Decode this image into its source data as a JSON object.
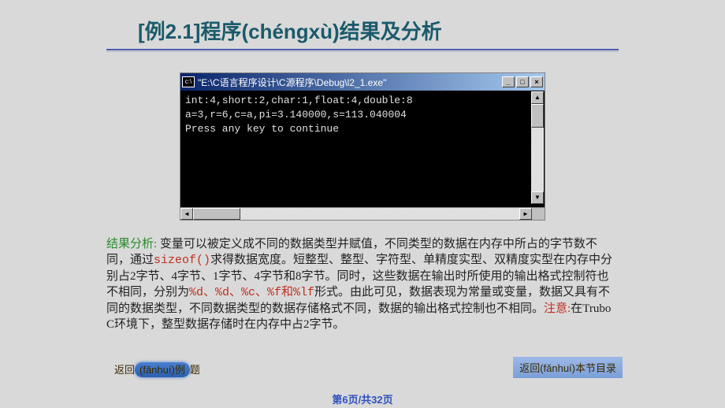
{
  "title": "[例2.1]程序(chéngxù)结果及分析",
  "console": {
    "titlebar": "\"E:\\C语言程序设计\\C源程序\\Debug\\l2_1.exe\"",
    "lines": [
      "int:4,short:2,char:1,float:4,double:8",
      "a=3,r=6,c=a,pi=3.140000,s=113.040004",
      "Press any key to continue"
    ],
    "buttons": {
      "min": "_",
      "max": "□",
      "close": "×"
    },
    "arrows": {
      "up": "▲",
      "down": "▼",
      "left": "◄",
      "right": "►"
    }
  },
  "analysis": {
    "label": "结果分析:",
    "body1": "变量可以被定义成不同的数据类型并赋值，不同类型的数据在内存中所占的字节数不同，通过",
    "code1": "sizeof()",
    "body2": "求得数据宽度。短整型、整型、字符型、单精度实型、双精度实型在内存中分别占2字节、4字节、1字节、4字节和8字节。同时，这些数据在输出时所使用的输出格式控制符也不相同，分别为",
    "code2": "%d、%d、%c、%f和%lf",
    "body3": "形式。由此可见，数据表现为常量或变量，数据又具有不同的数据类型，不同数据类型的数据存储格式不同，数据的输出格式控制也不相同。",
    "note_label": "注意:",
    "note_body": "在Trubo C环境下，整型数据存储时在内存中占2字节。"
  },
  "nav": {
    "left_prefix": "返回",
    "left_pill": "(fǎnhuí)例",
    "left_suffix": "题",
    "right": "返回(fǎnhuí)本节目录"
  },
  "footer": "第6页/共32页"
}
